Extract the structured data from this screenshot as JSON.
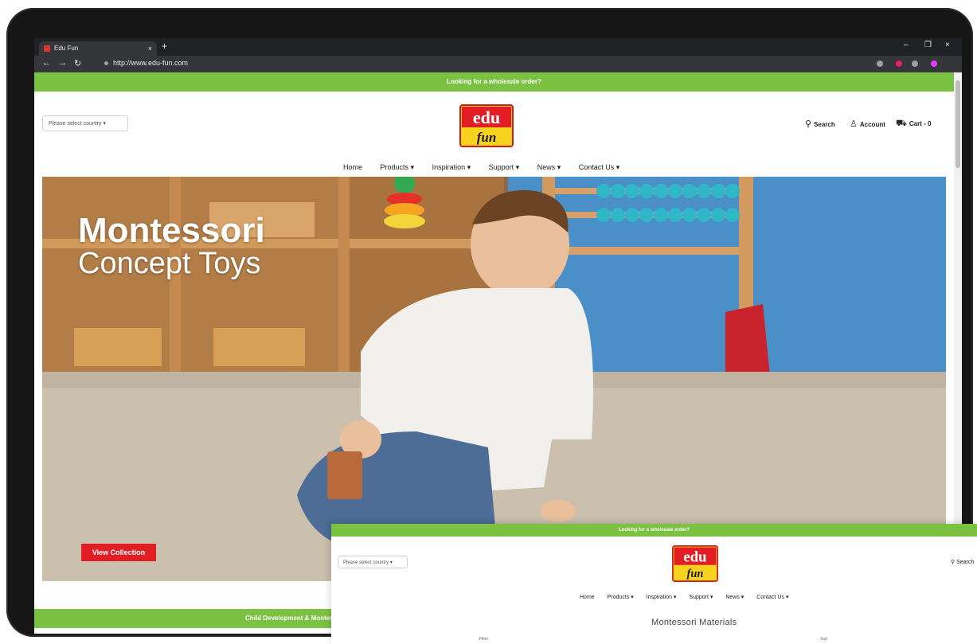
{
  "browser": {
    "tab_title": "Edu Fun",
    "tab_close": "×",
    "new_tab": "+",
    "url": "http://www.edu-fun.com",
    "back": "←",
    "forward": "→",
    "reload": "↻",
    "minimize": "–",
    "maximize": "❐",
    "close": "×"
  },
  "site": {
    "promo_text": "Looking for a wholesale order?",
    "country_select": "Please select country ▾",
    "logo_top": "edu",
    "logo_bottom": "fun",
    "search_label": "Search",
    "account_label": "Account",
    "cart_label": "Cart - 0",
    "nav": [
      "Home",
      "Products ▾",
      "Inspiration ▾",
      "Support ▾",
      "News ▾",
      "Contact Us ▾"
    ]
  },
  "hero": {
    "title_line1": "Montessori",
    "title_line2": "Concept Toys",
    "button": "View Collection"
  },
  "footer_strip": {
    "text": "Child Development & Montessori"
  },
  "overlay": {
    "promo_text": "Looking for a wholesale order?",
    "country_select": "Please select country ▾",
    "search_label": "Search",
    "nav": [
      "Home",
      "Products ▾",
      "Inspiration ▾",
      "Support ▾",
      "News ▾",
      "Contact Us ▾"
    ],
    "heading": "Montessori Materials",
    "filter_label": "Filter",
    "sort_label": "Sort"
  },
  "colors": {
    "brand_green": "#7cc242",
    "brand_red": "#e21d24",
    "logo_yellow": "#f7d21e"
  }
}
